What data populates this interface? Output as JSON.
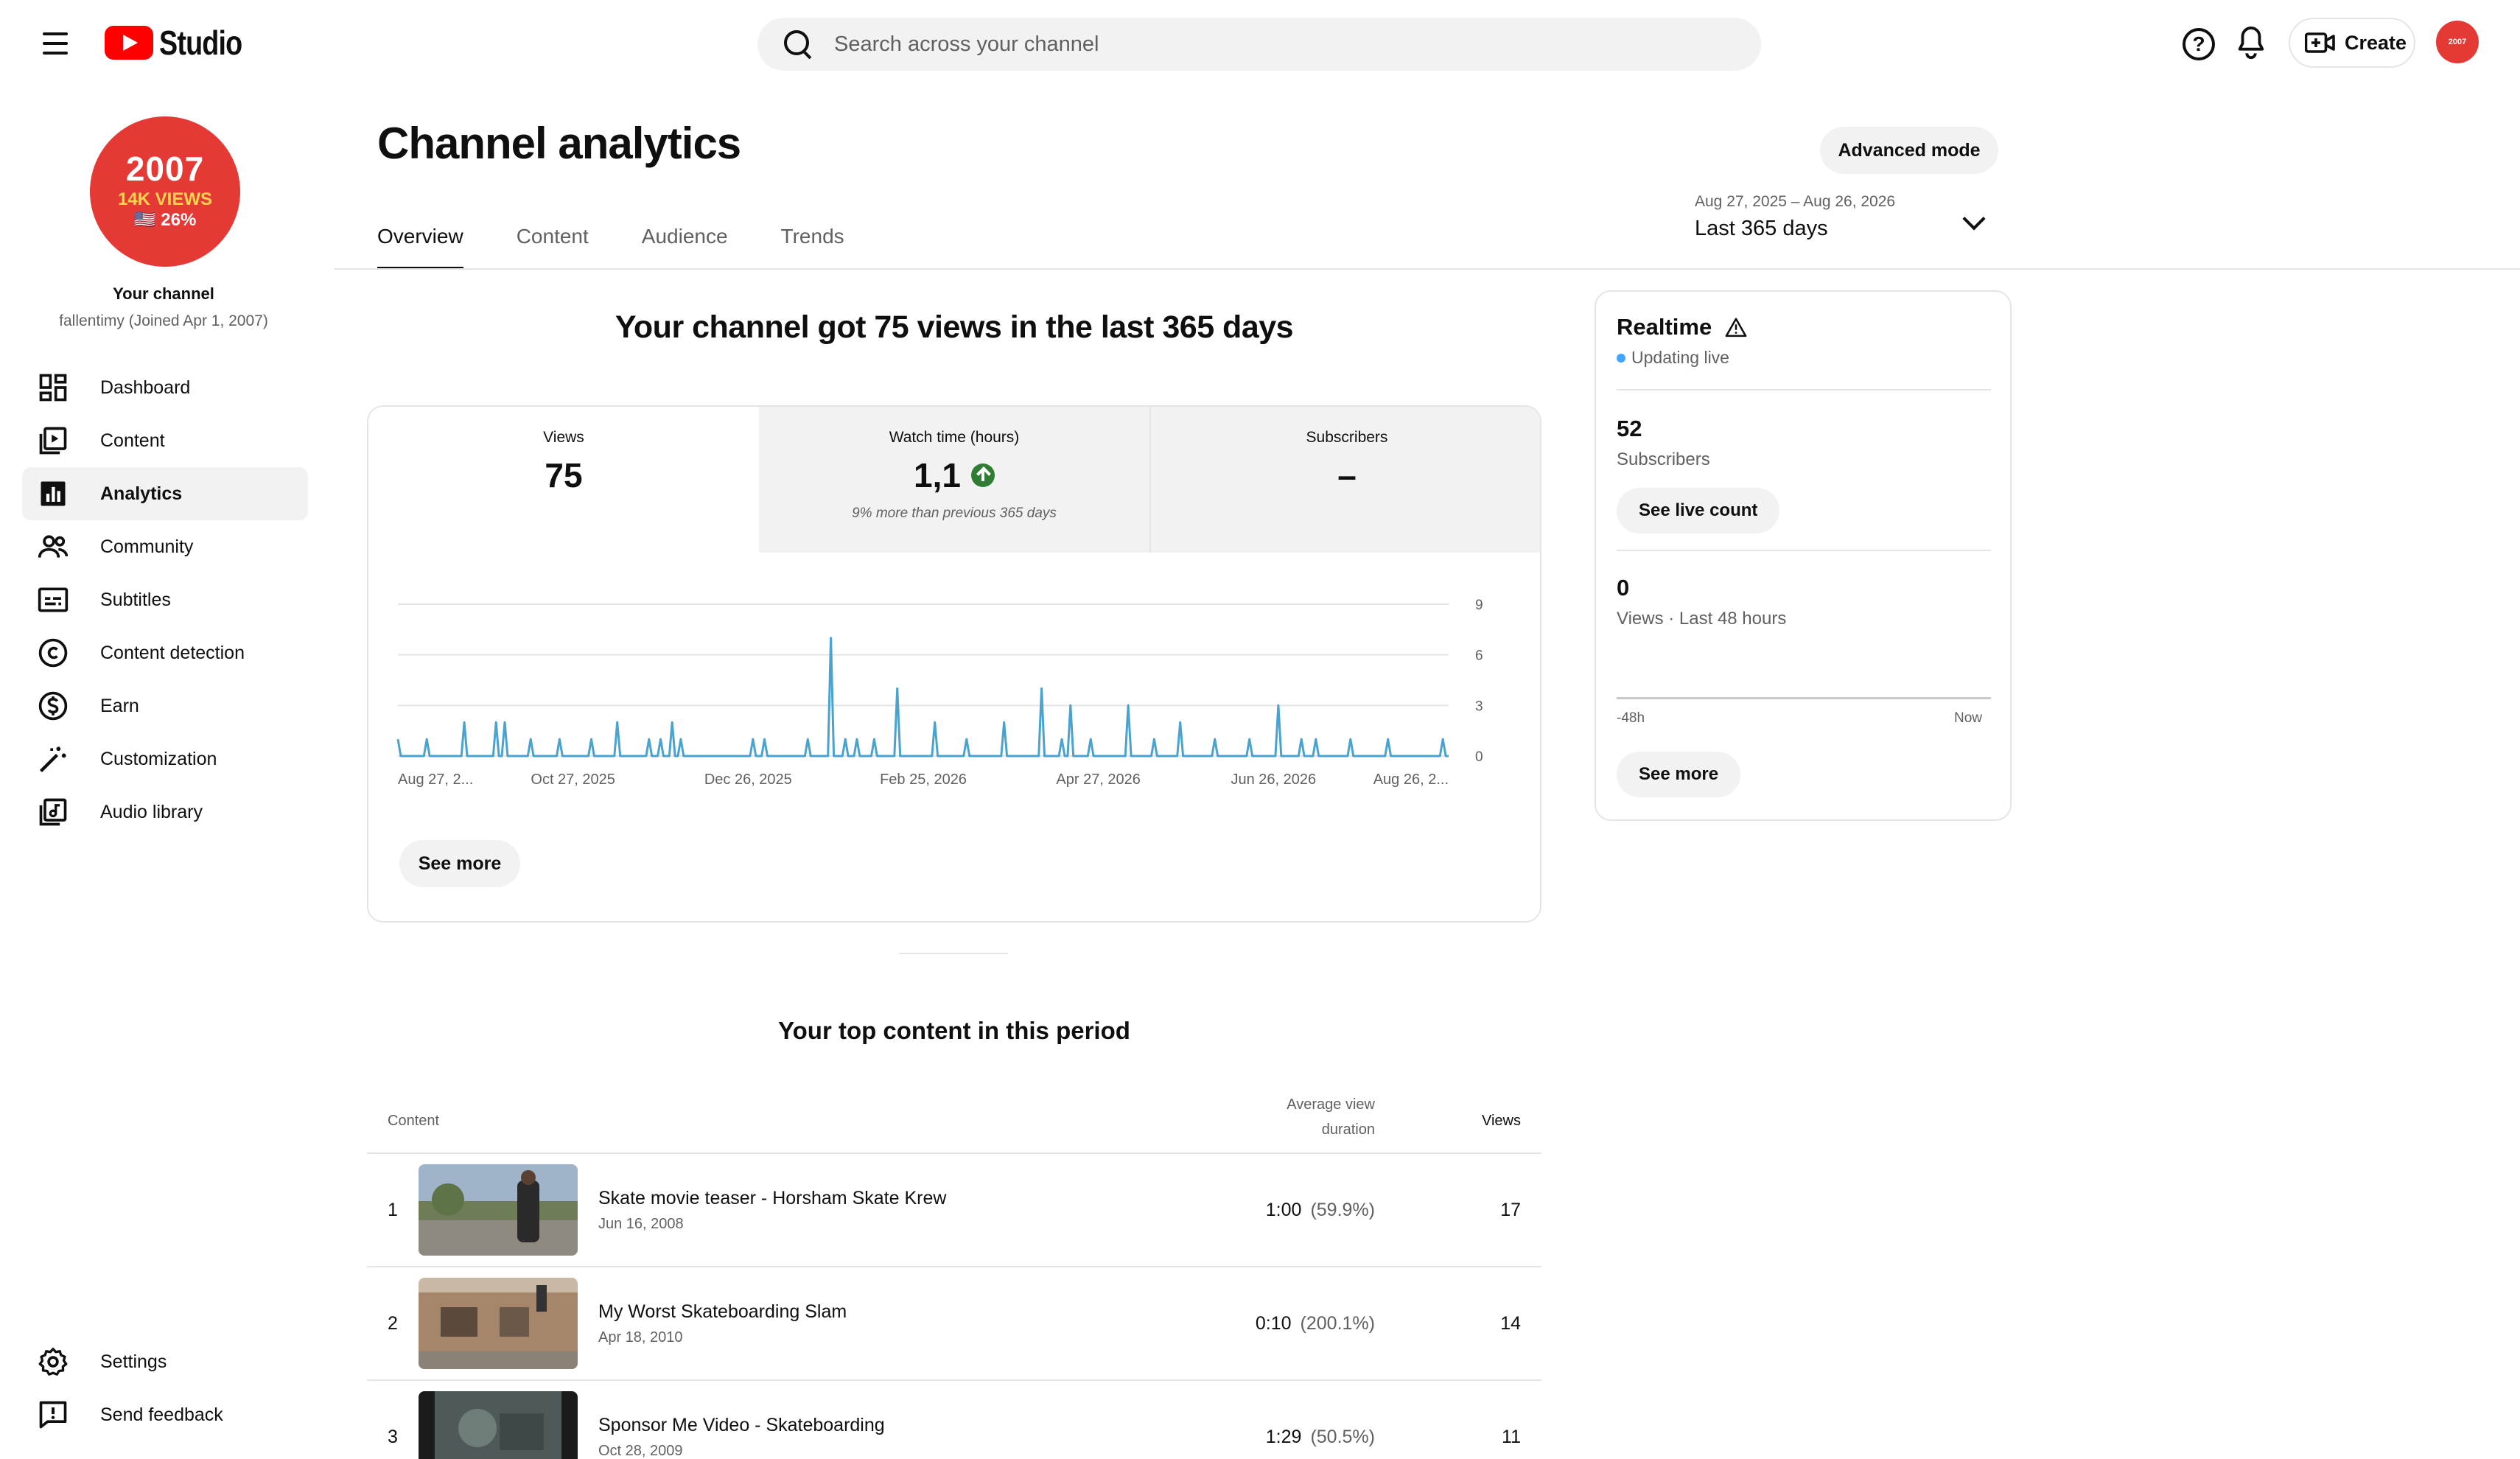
{
  "header": {
    "logo_text": "Studio",
    "search_placeholder": "Search across your channel",
    "help_symbol": "?",
    "create_label": "Create",
    "avatar_text": "2007"
  },
  "sidebar": {
    "avatar": {
      "year": "2007",
      "views": "14K VIEWS",
      "pct": "🇺🇸 26%"
    },
    "your_channel": "Your channel",
    "handle": "fallentimy (Joined Apr 1, 2007)",
    "items": [
      {
        "label": "Dashboard",
        "icon": "dashboard-icon",
        "active": false
      },
      {
        "label": "Content",
        "icon": "content-icon",
        "active": false
      },
      {
        "label": "Analytics",
        "icon": "analytics-icon",
        "active": true
      },
      {
        "label": "Community",
        "icon": "community-icon",
        "active": false
      },
      {
        "label": "Subtitles",
        "icon": "subtitles-icon",
        "active": false
      },
      {
        "label": "Content detection",
        "icon": "copyright-icon",
        "active": false
      },
      {
        "label": "Earn",
        "icon": "dollar-icon",
        "active": false
      },
      {
        "label": "Customization",
        "icon": "magic-wand-icon",
        "active": false
      },
      {
        "label": "Audio library",
        "icon": "audio-library-icon",
        "active": false
      }
    ],
    "bottom_items": [
      {
        "label": "Settings",
        "icon": "gear-icon"
      },
      {
        "label": "Send feedback",
        "icon": "feedback-icon"
      }
    ]
  },
  "main": {
    "title": "Channel analytics",
    "advanced_mode": "Advanced mode",
    "tabs": [
      "Overview",
      "Content",
      "Audience",
      "Trends"
    ],
    "active_tab": "Overview",
    "date_range": "Aug 27, 2025 – Aug 26, 2026",
    "date_label": "Last 365 days",
    "summary_heading": "Your channel got 75 views in the last 365 days",
    "metrics": [
      {
        "label": "Views",
        "value": "75",
        "note": ""
      },
      {
        "label": "Watch time (hours)",
        "value": "1,1",
        "note": "9% more than previous 365 days",
        "trend": "up"
      },
      {
        "label": "Subscribers",
        "value": "–",
        "note": ""
      }
    ],
    "see_more": "See more",
    "top_content_heading": "Your top content in this period",
    "table_headers": {
      "content": "Content",
      "avd_line1": "Average view",
      "avd_line2": "duration",
      "views": "Views"
    },
    "rows": [
      {
        "rank": "1",
        "title": "Skate movie teaser - Horsham Skate Krew",
        "date": "Jun 16, 2008",
        "avd": "1:00",
        "avd_pct": "(59.9%)",
        "views": "17"
      },
      {
        "rank": "2",
        "title": "My Worst Skateboarding Slam",
        "date": "Apr 18, 2010",
        "avd": "0:10",
        "avd_pct": "(200.1%)",
        "views": "14"
      },
      {
        "rank": "3",
        "title": "Sponsor Me Video - Skateboarding",
        "date": "Oct 28, 2009",
        "avd": "1:29",
        "avd_pct": "(50.5%)",
        "views": "11"
      }
    ]
  },
  "realtime": {
    "title": "Realtime",
    "live": "Updating live",
    "subs_value": "52",
    "subs_label": "Subscribers",
    "live_count_btn": "See live count",
    "views_value": "0",
    "views_label": "Views · Last 48 hours",
    "axis_start": "-48h",
    "axis_end": "Now",
    "see_more": "See more",
    "live_color": "#3ea6ff"
  },
  "colors": {
    "accent": "#ff0000",
    "chart_line": "#4aa3cf",
    "trend_up": "#2e7d32"
  },
  "chart_data": {
    "type": "line",
    "x_labels": [
      "Aug 27, 2...",
      "Oct 27, 2025",
      "Dec 26, 2025",
      "Feb 25, 2026",
      "Apr 27, 2026",
      "Jun 26, 2026",
      "Aug 26, 2..."
    ],
    "y_ticks": [
      "9",
      "6",
      "3",
      "0"
    ],
    "ylim": [
      0,
      9
    ],
    "days": 365,
    "series": [
      {
        "spikes": [
          [
            0,
            1
          ],
          [
            10,
            1
          ],
          [
            23,
            2
          ],
          [
            34,
            2
          ],
          [
            37,
            2
          ],
          [
            46,
            1
          ],
          [
            56,
            1
          ],
          [
            67,
            1
          ],
          [
            76,
            2
          ],
          [
            87,
            1
          ],
          [
            91,
            1
          ],
          [
            95,
            2
          ],
          [
            98,
            1
          ],
          [
            123,
            1
          ],
          [
            127,
            1
          ],
          [
            142,
            1
          ],
          [
            150,
            7
          ],
          [
            155,
            1
          ],
          [
            159,
            1
          ],
          [
            165,
            1
          ],
          [
            173,
            4
          ],
          [
            186,
            2
          ],
          [
            197,
            1
          ],
          [
            210,
            2
          ],
          [
            223,
            4
          ],
          [
            230,
            1
          ],
          [
            233,
            3
          ],
          [
            240,
            1
          ],
          [
            253,
            3
          ],
          [
            262,
            1
          ],
          [
            271,
            2
          ],
          [
            283,
            1
          ],
          [
            295,
            1
          ],
          [
            305,
            3
          ],
          [
            313,
            1
          ],
          [
            318,
            1
          ],
          [
            330,
            1
          ],
          [
            343,
            1
          ],
          [
            362,
            1
          ]
        ]
      }
    ],
    "grid": true
  }
}
